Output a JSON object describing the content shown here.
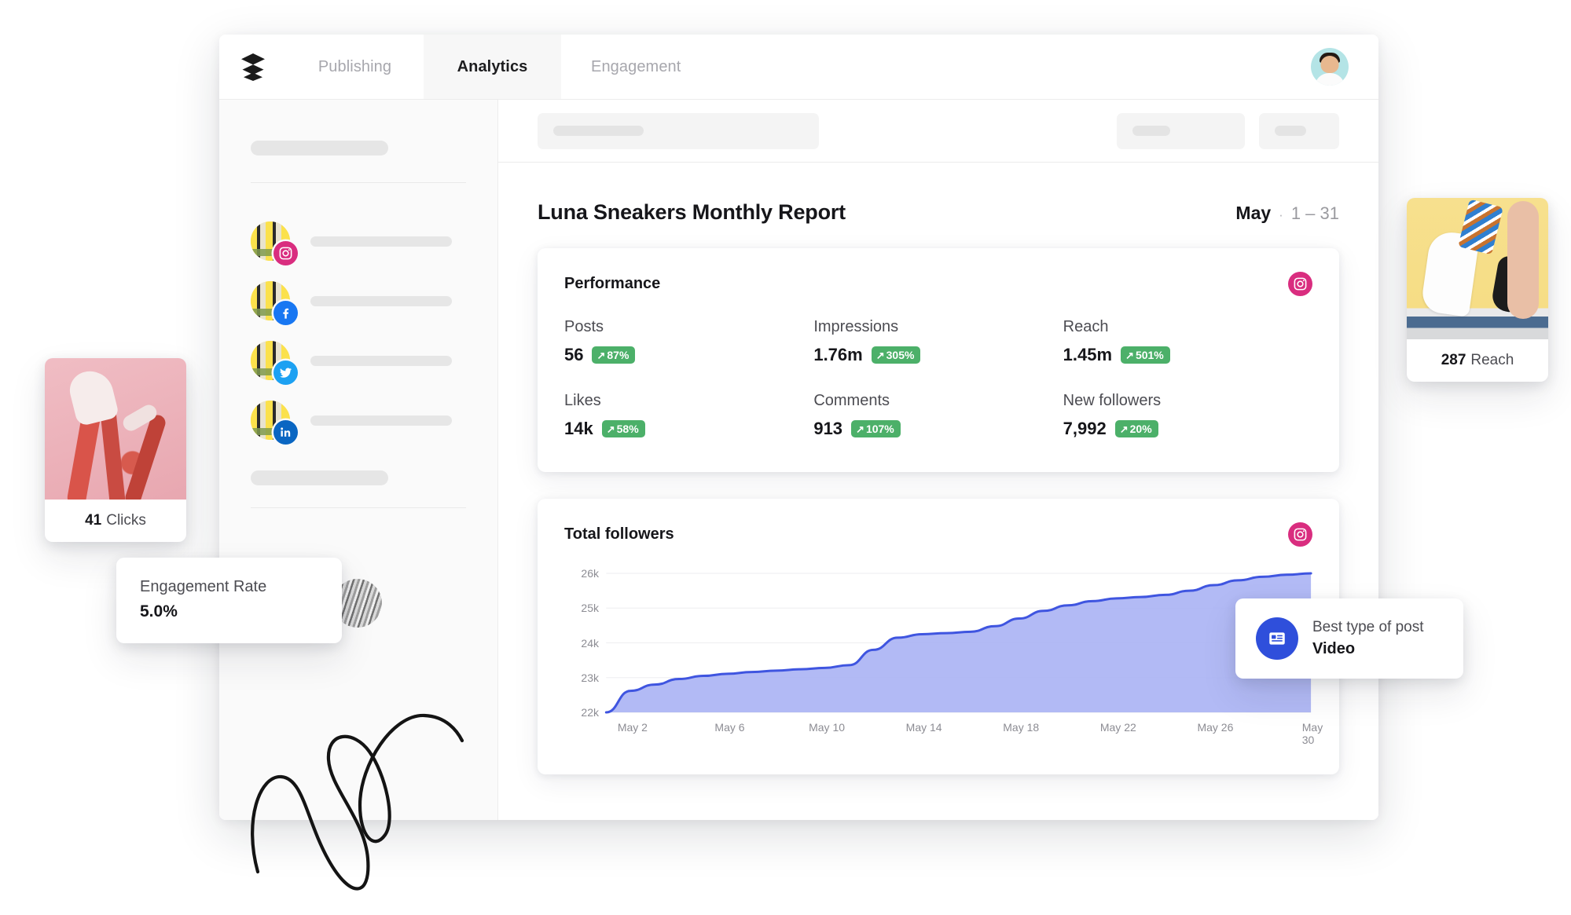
{
  "nav": {
    "logo_icon": "buffer-layers-logo",
    "tabs": [
      {
        "label": "Publishing",
        "active": false
      },
      {
        "label": "Analytics",
        "active": true
      },
      {
        "label": "Engagement",
        "active": false
      }
    ],
    "avatar_alt": "user-avatar"
  },
  "sidebar": {
    "channels": [
      {
        "network": "instagram",
        "icon": "instagram-icon"
      },
      {
        "network": "facebook",
        "icon": "facebook-icon"
      },
      {
        "network": "twitter",
        "icon": "twitter-icon"
      },
      {
        "network": "linkedin",
        "icon": "linkedin-icon"
      }
    ]
  },
  "report": {
    "title": "Luna Sneakers Monthly Report",
    "month": "May",
    "separator": "·",
    "date_range": "1 – 31"
  },
  "performance": {
    "title": "Performance",
    "network_icon": "instagram-icon",
    "stats": [
      {
        "label": "Posts",
        "value": "56",
        "delta": "87%",
        "arrow": "↗",
        "trend": "up"
      },
      {
        "label": "Impressions",
        "value": "1.76m",
        "delta": "305%",
        "arrow": "↗",
        "trend": "up"
      },
      {
        "label": "Reach",
        "value": "1.45m",
        "delta": "501%",
        "arrow": "↗",
        "trend": "up"
      },
      {
        "label": "Likes",
        "value": "14k",
        "delta": "58%",
        "arrow": "↗",
        "trend": "up"
      },
      {
        "label": "Comments",
        "value": "913",
        "delta": "107%",
        "arrow": "↗",
        "trend": "up"
      },
      {
        "label": "New followers",
        "value": "7,992",
        "delta": "20%",
        "arrow": "↗",
        "trend": "up"
      }
    ]
  },
  "followers_card": {
    "title": "Total followers",
    "network_icon": "instagram-icon"
  },
  "chart_data": {
    "type": "area",
    "title": "Total followers",
    "xlabel": "",
    "ylabel": "",
    "ylim": [
      22000,
      26000
    ],
    "y_ticks": [
      "22k",
      "23k",
      "24k",
      "25k",
      "26k"
    ],
    "y_tick_values": [
      22000,
      23000,
      24000,
      25000,
      26000
    ],
    "x_ticks": [
      "May 2",
      "May 6",
      "May 10",
      "May 14",
      "May 18",
      "May 22",
      "May 26",
      "May 30"
    ],
    "grid": true,
    "legend": "none",
    "line_color": "#3f55e0",
    "fill_color": "#aab2f4",
    "x": [
      "May 1",
      "May 2",
      "May 3",
      "May 4",
      "May 5",
      "May 6",
      "May 7",
      "May 8",
      "May 9",
      "May 10",
      "May 11",
      "May 12",
      "May 13",
      "May 14",
      "May 15",
      "May 16",
      "May 17",
      "May 18",
      "May 19",
      "May 20",
      "May 21",
      "May 22",
      "May 23",
      "May 24",
      "May 25",
      "May 26",
      "May 27",
      "May 28",
      "May 29",
      "May 30"
    ],
    "values": [
      22000,
      22620,
      22800,
      22960,
      23050,
      23110,
      23160,
      23200,
      23240,
      23280,
      23360,
      23800,
      24150,
      24250,
      24280,
      24320,
      24480,
      24700,
      24920,
      25080,
      25200,
      25280,
      25320,
      25380,
      25500,
      25660,
      25800,
      25900,
      25960,
      26000
    ]
  },
  "floating": {
    "clicks": {
      "value": "41",
      "label": "Clicks",
      "photo_alt": "sneaker-hands-pink-photo"
    },
    "reach": {
      "value": "287",
      "label": "Reach",
      "photo_alt": "white-sneaker-yellow-photo"
    },
    "engagement": {
      "label": "Engagement Rate",
      "value": "5.0%"
    },
    "best_type": {
      "label": "Best type of post",
      "value": "Video",
      "icon": "article-post-icon"
    }
  },
  "toolbar": {
    "placeholders": [
      "search-placeholder",
      "filter-placeholder",
      "range-placeholder"
    ]
  },
  "colors": {
    "accent_blue": "#3f55e0",
    "instagram": "#d92d7f",
    "facebook": "#1877f2",
    "twitter": "#1da1f2",
    "linkedin": "#0a66c2",
    "badge_green": "#4cb069",
    "chart_fill": "#aab2f4"
  }
}
